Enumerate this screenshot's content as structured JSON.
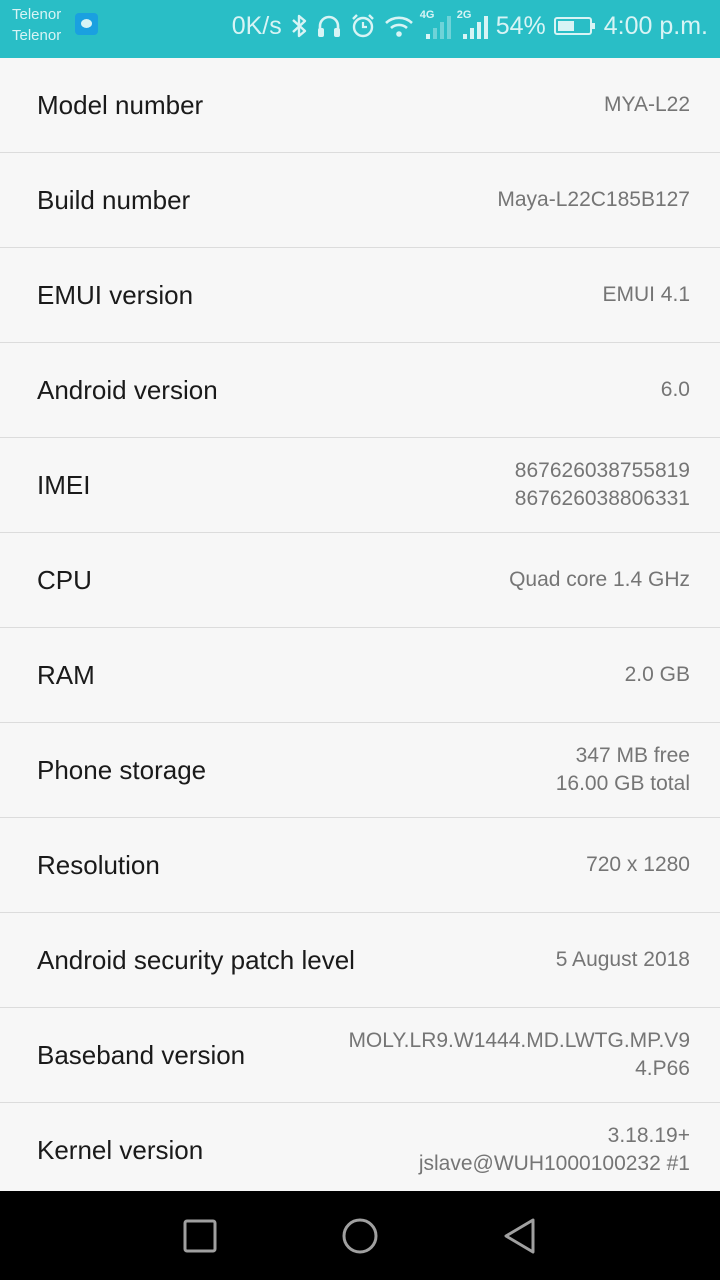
{
  "status_bar": {
    "carriers": [
      "Telenor",
      "Telenor"
    ],
    "net_speed": "0K/s",
    "network_tags": [
      "4G",
      "2G"
    ],
    "battery_percent_label": "54%",
    "battery_level": 0.54,
    "time": "4:00 p.m.",
    "color": "#29bec6"
  },
  "rows": [
    {
      "label": "Model number",
      "value": "MYA-L22"
    },
    {
      "label": "Build number",
      "value": "Maya-L22C185B127"
    },
    {
      "label": "EMUI version",
      "value": "EMUI 4.1"
    },
    {
      "label": "Android version",
      "value": "6.0"
    },
    {
      "label": "IMEI",
      "value": "867626038755819\n867626038806331"
    },
    {
      "label": "CPU",
      "value": "Quad core 1.4 GHz"
    },
    {
      "label": "RAM",
      "value": "2.0 GB"
    },
    {
      "label": "Phone storage",
      "value": "347  MB free\n16.00  GB total"
    },
    {
      "label": "Resolution",
      "value": "720 x 1280"
    },
    {
      "label": "Android security patch level",
      "value": "5 August 2018"
    },
    {
      "label": "Baseband version",
      "value": "MOLY.LR9.W1444.MD.LWTG.MP.V9\n4.P66"
    },
    {
      "label": "Kernel version",
      "value": "3.18.19+\njslave@WUH1000100232 #1"
    }
  ],
  "nav_bar": {
    "buttons": [
      "recents",
      "home",
      "back"
    ]
  }
}
